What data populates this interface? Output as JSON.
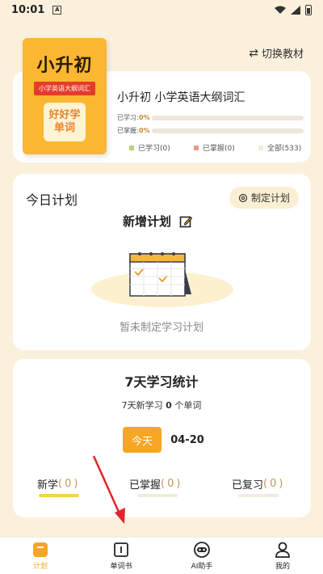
{
  "status": {
    "time": "10:01",
    "notif": "A"
  },
  "header": {
    "switch_label": "切换教材"
  },
  "book": {
    "cover_title": "小升初",
    "cover_subtitle": "小学英语大纲词汇",
    "cover_box_line1": "好好学",
    "cover_box_line2": "单词",
    "name": "小升初 小学英语大纲词汇",
    "learned_label": "已学习:",
    "learned_pct": "0%",
    "mastered_label": "已掌握:",
    "mastered_pct": "0%",
    "legend": [
      {
        "label": "已学习(0)",
        "color": "#b5d67a"
      },
      {
        "label": "已掌握(0)",
        "color": "#e99a86"
      },
      {
        "label": "全部(533)",
        "color": "#f1ead9"
      }
    ]
  },
  "plan": {
    "title": "今日计划",
    "set_button": "制定计划",
    "new_plan": "新增计划",
    "empty_text": "暂未制定学习计划"
  },
  "stats": {
    "title": "7天学习统计",
    "sub_prefix": "7天新学习",
    "sub_count": "0",
    "sub_suffix": "个单词",
    "today": "今天",
    "date": "04-20",
    "items": [
      {
        "label": "新学",
        "count": "0",
        "color": "#f3d34a"
      },
      {
        "label": "已掌握",
        "count": "0",
        "color": "#e8efdb"
      },
      {
        "label": "已复习",
        "count": "0",
        "color": "#f1ece1"
      }
    ]
  },
  "tabs": [
    {
      "label": "计划"
    },
    {
      "label": "单词书"
    },
    {
      "label": "AI助手"
    },
    {
      "label": "我的"
    }
  ],
  "colors": {
    "accent": "#f5a623",
    "background": "#fbf0db"
  }
}
